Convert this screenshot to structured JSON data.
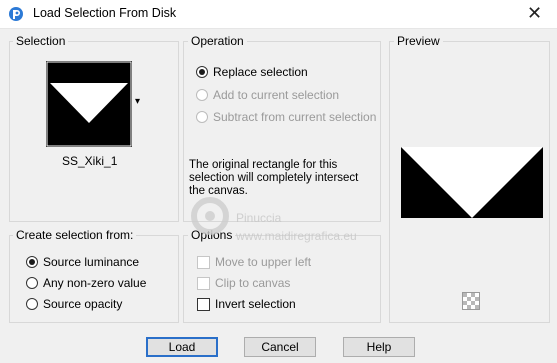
{
  "window": {
    "title": "Load Selection From Disk",
    "close_symbol": "✕"
  },
  "selection_group": {
    "title": "Selection",
    "file_name": "SS_Xiki_1",
    "dropdown_symbol": "▾"
  },
  "operation_group": {
    "title": "Operation",
    "options": [
      {
        "label": "Replace selection",
        "checked": true,
        "enabled": true
      },
      {
        "label": "Add to current selection",
        "checked": false,
        "enabled": false
      },
      {
        "label": "Subtract from current selection",
        "checked": false,
        "enabled": false
      }
    ],
    "note": "The original rectangle for this selection will completely intersect the canvas."
  },
  "preview_group": {
    "title": "Preview"
  },
  "create_group": {
    "title": "Create selection from:",
    "options": [
      {
        "label": "Source luminance",
        "checked": true
      },
      {
        "label": "Any non-zero value",
        "checked": false
      },
      {
        "label": "Source opacity",
        "checked": false
      }
    ]
  },
  "options_group": {
    "title": "Options",
    "items": [
      {
        "label": "Move to upper left",
        "checked": false,
        "enabled": false
      },
      {
        "label": "Clip to canvas",
        "checked": false,
        "enabled": false
      },
      {
        "label": "Invert selection",
        "checked": false,
        "enabled": true
      }
    ]
  },
  "buttons": {
    "load": "Load",
    "cancel": "Cancel",
    "help": "Help"
  },
  "watermark": {
    "line1": "Pinuccia",
    "line2": "www.maidiregrafica.eu"
  },
  "colors": {
    "accent": "#2a6fc9",
    "dialog_bg": "#f0f0f0",
    "preview_black": "#000000",
    "preview_white": "#ffffff"
  },
  "icons": {
    "app": "app-logo-icon",
    "close": "close-icon",
    "dropdown": "chevron-down-icon",
    "transparency": "transparency-grid-icon"
  }
}
